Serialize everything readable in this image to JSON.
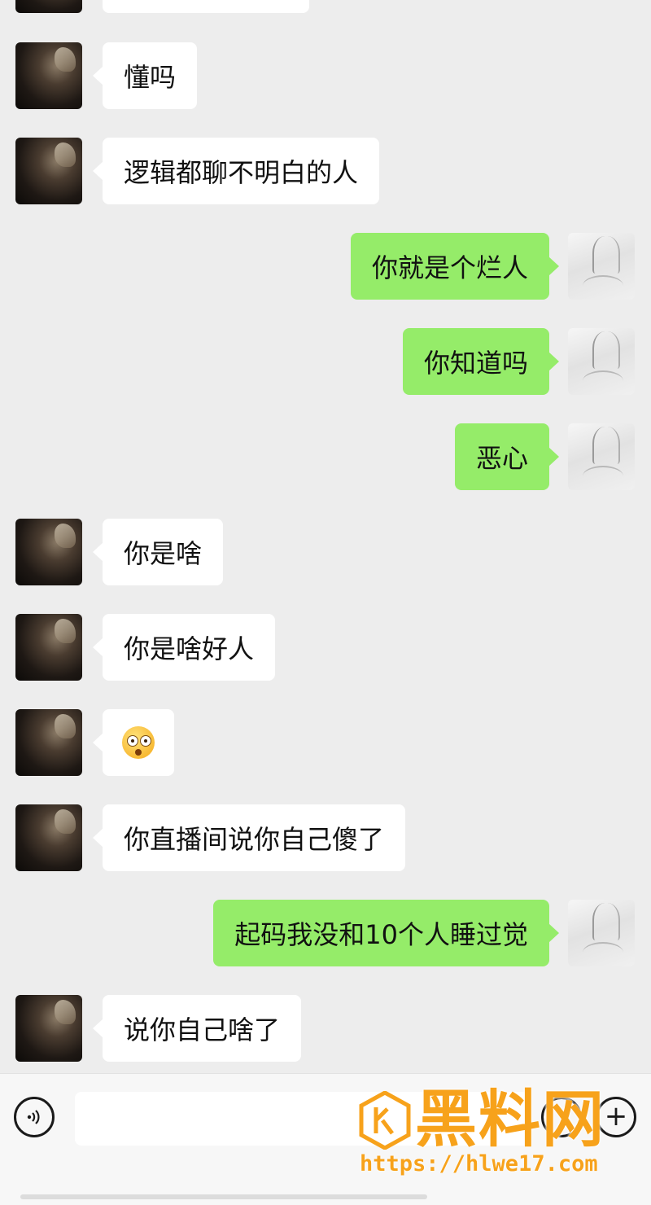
{
  "messages": [
    {
      "side": "left",
      "text": "懂吗"
    },
    {
      "side": "left",
      "text": "逻辑都聊不明白的人"
    },
    {
      "side": "right",
      "text": "你就是个烂人"
    },
    {
      "side": "right",
      "text": "你知道吗"
    },
    {
      "side": "right",
      "text": "恶心"
    },
    {
      "side": "left",
      "text": "你是啥"
    },
    {
      "side": "left",
      "text": "你是啥好人"
    },
    {
      "side": "left",
      "text": "",
      "emoji": "flushed-face-emoji"
    },
    {
      "side": "left",
      "text": "你直播间说你自己傻了"
    },
    {
      "side": "right",
      "text": "起码我没和10个人睡过觉"
    },
    {
      "side": "left",
      "text": "说你自己啥了"
    }
  ],
  "input_bar": {
    "voice_icon": "voice-icon",
    "emoji_icon": "emoji-icon",
    "plus_icon": "plus-icon"
  },
  "watermark": {
    "brand": "黑料网",
    "url": "https://hlwe17.com"
  },
  "colors": {
    "background": "#ededed",
    "incoming_bubble": "#ffffff",
    "outgoing_bubble": "#95ec69",
    "watermark": "#f7a21b"
  }
}
